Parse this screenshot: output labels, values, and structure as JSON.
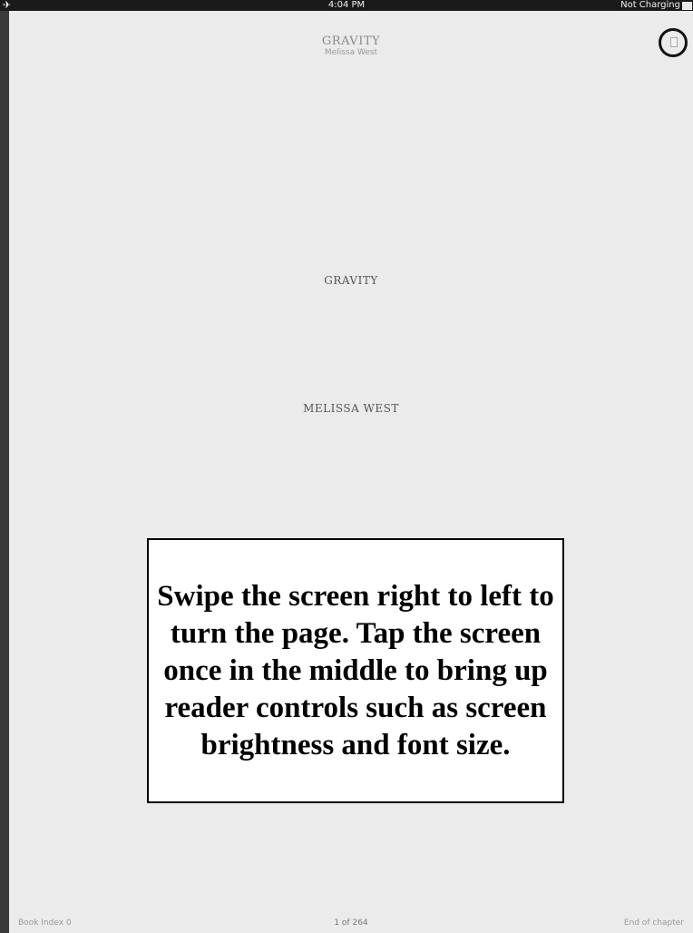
{
  "status_bar": {
    "airplane_icon": "airplane-icon",
    "time": "4:04 PM",
    "charging_text": "Not Charging",
    "battery_icon": "battery-icon"
  },
  "header": {
    "title": "GRAVITY",
    "author": "Melissa West",
    "bookmark_icon": "bookmark-icon"
  },
  "page": {
    "title": "GRAVITY",
    "author": "MELISSA WEST"
  },
  "callout": {
    "text": "Swipe the screen right to left to turn the page. Tap the screen once in the middle to bring up reader controls such as screen brightness and font size."
  },
  "footer": {
    "left": "Book Index 0",
    "center": "1 of 264",
    "right": "End of chapter"
  }
}
